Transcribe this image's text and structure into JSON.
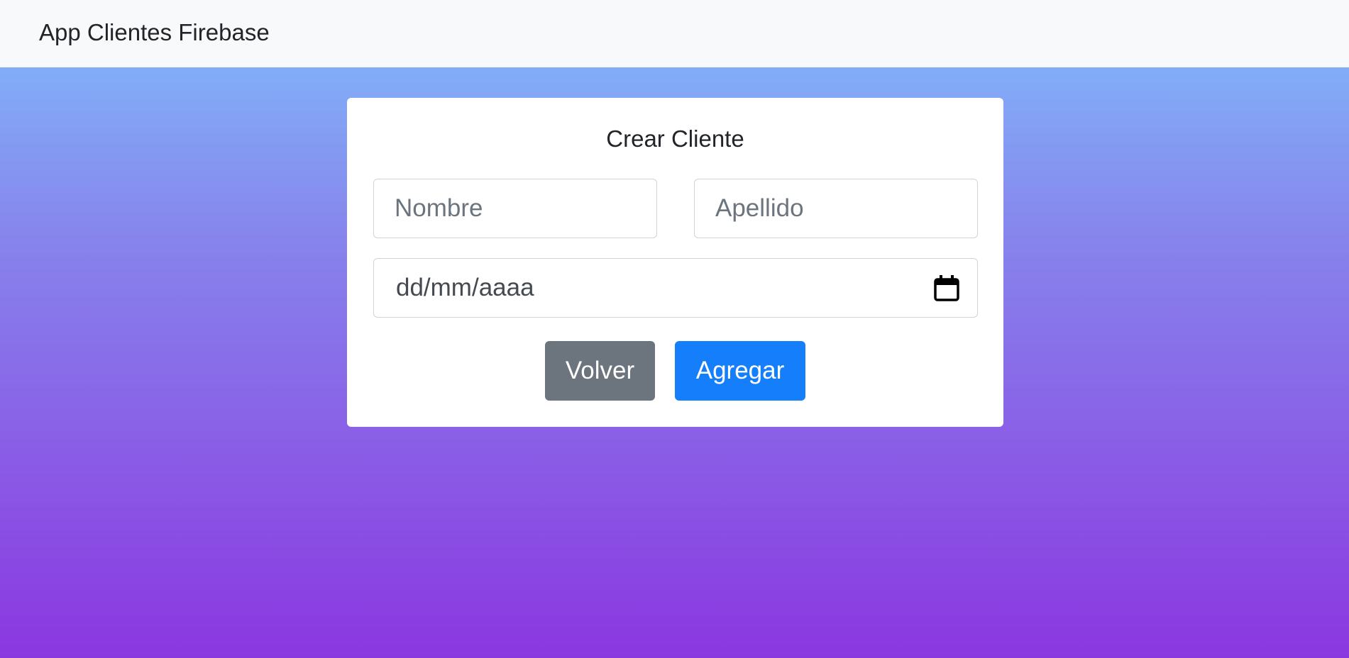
{
  "navbar": {
    "brand": "App Clientes Firebase"
  },
  "form": {
    "title": "Crear Cliente",
    "nombre_placeholder": "Nombre",
    "apellido_placeholder": "Apellido",
    "date_placeholder": "dd/mm/aaaa",
    "date_icon": "calendar-icon",
    "volver_label": "Volver",
    "agregar_label": "Agregar"
  },
  "colors": {
    "navbar_bg": "#f8f9fa",
    "gradient_top": "#82adf7",
    "gradient_bottom": "#8a37e0",
    "secondary_button": "#6c757d",
    "primary_button": "#157ffb"
  }
}
